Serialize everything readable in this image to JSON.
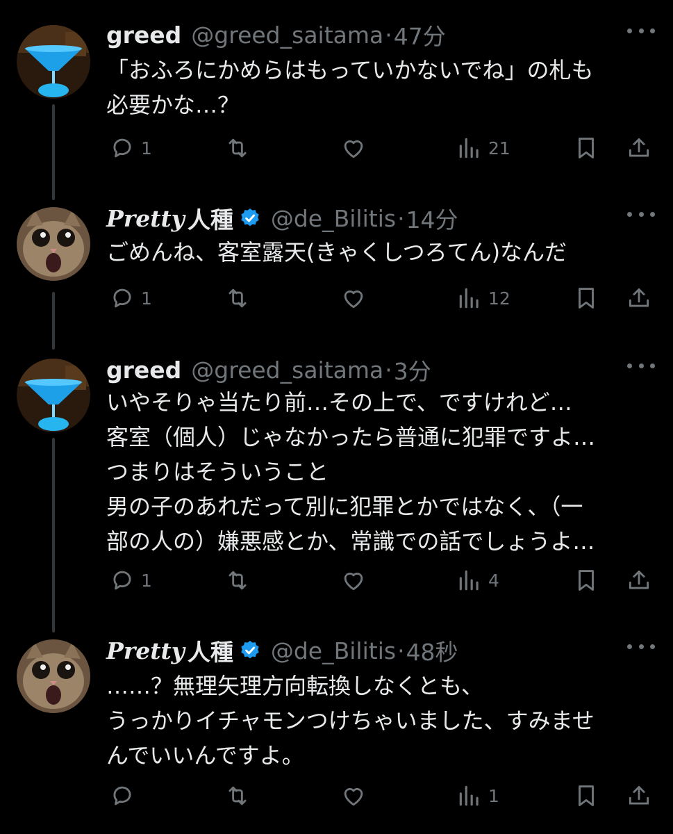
{
  "theme": {
    "background": "#000000",
    "text": "#e7e9ea",
    "muted": "#71767b",
    "verified": "#1d9bf0",
    "thread_line": "#333639"
  },
  "tweets": [
    {
      "author": {
        "name": "greed",
        "handle": "@greed_saitama",
        "verified": false,
        "avatar": "blue-cocktail-avatar"
      },
      "separator": "·",
      "time": "47分",
      "lines": [
        "「おふろにかめらはもっていかないでね」の札も",
        "必要かな…？"
      ],
      "replies": "1",
      "reposts": "",
      "likes": "",
      "views": "21"
    },
    {
      "author": {
        "name_serif": "Pretty",
        "name_kanji": "人種",
        "handle": "@de_Bilitis",
        "verified": true,
        "avatar": "screaming-cat-avatar"
      },
      "separator": "·",
      "time": "14分",
      "lines": [
        "ごめんね、客室露天(きゃくしつろてん)なんだ"
      ],
      "replies": "1",
      "reposts": "",
      "likes": "",
      "views": "12"
    },
    {
      "author": {
        "name": "greed",
        "handle": "@greed_saitama",
        "verified": false,
        "avatar": "blue-cocktail-avatar"
      },
      "separator": "·",
      "time": "3分",
      "lines": [
        "いやそりゃ当たり前…その上で、ですけれど…",
        "客室（個人）じゃなかったら普通に犯罪ですよ…",
        "つまりはそういうこと",
        "男の子のあれだって別に犯罪とかではなく、（一",
        "部の人の）嫌悪感とか、常識での話でしょうよ…"
      ],
      "replies": "1",
      "reposts": "",
      "likes": "",
      "views": "4"
    },
    {
      "author": {
        "name_serif": "Pretty",
        "name_kanji": "人種",
        "handle": "@de_Bilitis",
        "verified": true,
        "avatar": "screaming-cat-avatar"
      },
      "separator": "·",
      "time": "48秒",
      "lines": [
        "……？無理矢理方向転換しなくとも、",
        "うっかりイチャモンつけちゃいました、すみませ",
        "んでいいんですよ。"
      ],
      "replies": "",
      "reposts": "",
      "likes": "",
      "views": "1"
    }
  ]
}
